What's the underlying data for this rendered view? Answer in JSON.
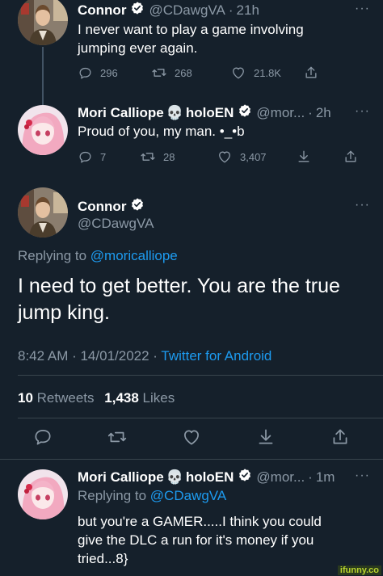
{
  "tweet1": {
    "display_name": "Connor",
    "handle": "@CDawgVA",
    "time": "21h",
    "text_line1": "I never want to play a game involving",
    "text_line2": "jumping ever again.",
    "replies": "296",
    "retweets": "268",
    "likes": "21.8K"
  },
  "tweet2": {
    "display_name": "Mori Calliope",
    "name_emoji": "💀",
    "name_suffix": "holoEN",
    "handle": "@mor...",
    "time": "2h",
    "text": "Proud of you, my man. •_•b",
    "replies": "7",
    "retweets": "28",
    "likes": "3,407"
  },
  "main_tweet": {
    "display_name": "Connor",
    "handle": "@CDawgVA",
    "replying_prefix": "Replying to",
    "replying_to": "@moricalliope",
    "text_line1": "I need to get better. You are the true",
    "text_line2": "jump king.",
    "timestamp": "8:42 AM · 14/01/2022 · ",
    "client": "Twitter for Android",
    "retweets_count": "10",
    "retweets_label": "Retweets",
    "likes_count": "1,438",
    "likes_label": "Likes"
  },
  "reply": {
    "display_name": "Mori Calliope",
    "name_emoji": "💀",
    "name_suffix": "holoEN",
    "handle": "@mor...",
    "time": "1m",
    "replying_prefix": "Replying to",
    "replying_to": "@CDawgVA",
    "text_line1": "but you're a GAMER.....I think you could",
    "text_line2": "give the DLC a run for it's money if you",
    "text_line3": "tried...8}"
  },
  "more_label": "···",
  "dot": "·",
  "watermark": "ifunny.co",
  "colors": {
    "background": "#15202b",
    "muted": "#8b98a5",
    "accent": "#1d9bf0",
    "divider": "#38444d"
  },
  "icons": [
    "reply-icon",
    "retweet-icon",
    "like-icon",
    "download-icon",
    "share-icon",
    "verified-icon",
    "more-icon"
  ]
}
